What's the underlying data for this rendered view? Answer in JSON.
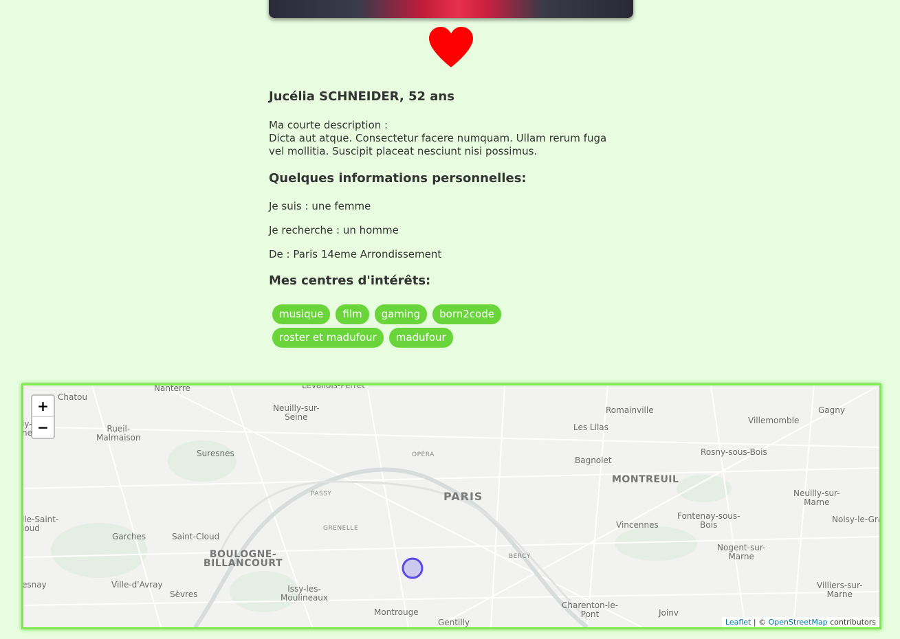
{
  "profile": {
    "name_line": "Jucélia SCHNEIDER, 52 ans",
    "description_label": "Ma courte description :",
    "description_text": "Dicta aut atque. Consectetur facere numquam. Ullam rerum fuga vel mollitia. Suscipit placeat nesciunt nisi possimus.",
    "info_heading": "Quelques informations personnelles:",
    "gender": "Je suis : une femme",
    "looking_for": "Je recherche : un homme",
    "location": "De : Paris 14eme Arrondissement",
    "interests_heading": "Mes centres d'intérêts:",
    "interests": [
      "musique",
      "film",
      "gaming",
      "born2code",
      "roster et madufour",
      "madufour"
    ]
  },
  "like_icon": "heart-icon",
  "colors": {
    "heart": "#ff0000",
    "tag": "#6ad43b",
    "map_border": "#7be84d",
    "marker": "#5a4be8"
  },
  "map": {
    "zoom_in": "+",
    "zoom_out": "−",
    "attribution": {
      "leaflet": "Leaflet",
      "sep": " | © ",
      "osm": "OpenStreetMap",
      "suffix": " contributors"
    },
    "labels": {
      "nanterre": "Nanterre",
      "levallois": "Levallois-Perret",
      "chatou": "Chatou",
      "neuilly": "Neuilly-sur-\nSeine",
      "romainville": "Romainville",
      "gagny": "Gagny",
      "villemomble": "Villemomble",
      "les_lilas": "Les Lilas",
      "rueil": "Rueil-\nMalmaison",
      "ly_ne": "ly-\nne",
      "suresnes": "Suresnes",
      "opera": "OPÉRA",
      "bagnolet": "Bagnolet",
      "rosny": "Rosny-sous-Bois",
      "montreuil": "MONTREUIL",
      "passy": "PASSY",
      "paris": "PARIS",
      "neuilly_marne": "Neuilly-sur-\nMarne",
      "cloud_left": "lle-Saint-\nloud",
      "fontenay": "Fontenay-sous-\nBois",
      "noisy": "Noisy-le-Gra",
      "garches": "Garches",
      "saint_cloud": "Saint-Cloud",
      "grenelle": "GRENELLE",
      "vincennes": "Vincennes",
      "bercy": "BERCY",
      "boulogne": "BOULOGNE-\nBILLANCOURT",
      "nogent": "Nogent-sur-\nMarne",
      "esnay": "esnay",
      "ville_avray": "Ville-d'Avray",
      "issy": "Issy-les-\nMoulineaux",
      "villiers": "Villiers-sur-\nMarne",
      "sevres": "Sèvres",
      "charenton": "Charenton-le-\nPont",
      "montrouge": "Montrouge",
      "joinv": "Joinv",
      "gentilly": "Gentilly"
    }
  }
}
